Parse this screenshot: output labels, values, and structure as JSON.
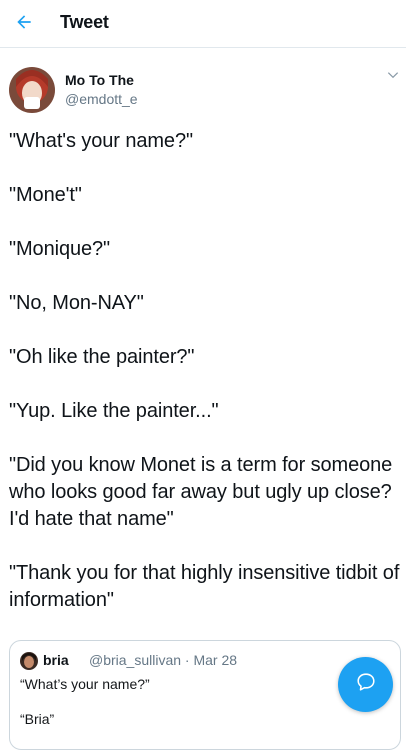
{
  "header": {
    "title": "Tweet",
    "back_icon": "arrow-left-icon"
  },
  "author": {
    "name": "Mo To The",
    "handle": "@emdott_e",
    "more_icon": "chevron-down-icon"
  },
  "tweet": {
    "lines": [
      "\"What's your name?\"",
      "\"Mone't\"",
      "\"Monique?\"",
      "\"No, Mon-NAY\"",
      "\"Oh like the painter?\"",
      "\"Yup. Like the painter...\"",
      "\"Did you know Monet is a term for someone who looks good far away but ugly up close? I'd hate that name\"",
      "\"Thank you for that highly insensitive tidbit of information\""
    ]
  },
  "quote": {
    "name": "bria",
    "handle_date": "@bria_sullivan · Mar 28",
    "line1": "“What’s your name?”",
    "line2": "“Bria”"
  },
  "fab": {
    "icon": "reply-bubble-icon"
  },
  "colors": {
    "accent": "#1da1f2",
    "text": "#0f1419",
    "muted": "#657786",
    "border": "#e1e8ed"
  }
}
